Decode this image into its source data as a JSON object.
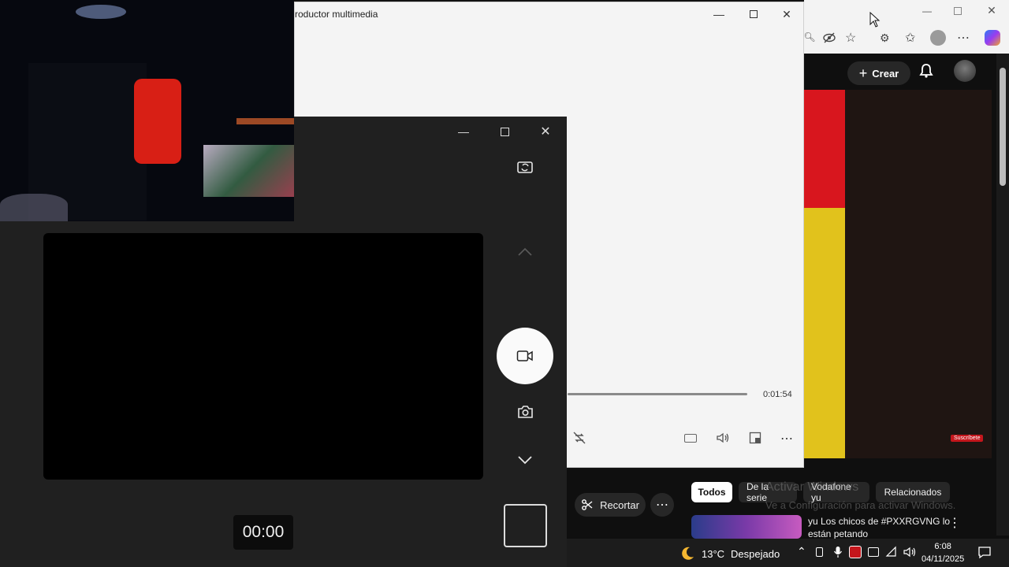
{
  "media_player": {
    "title": "roductor multimedia",
    "time_remaining": "0:01:54"
  },
  "camera": {
    "timer": "00:00"
  },
  "youtube": {
    "create_label": "Crear",
    "subscribe_badge": "Suscríbete",
    "cut_label": "Recortar",
    "more_label": "⋯",
    "chips": [
      "Todos",
      "De la serie",
      "Vodafone yu",
      "Relacionados"
    ],
    "recommended_title": "yu Los chicos de #PXXRGVNG lo están petando",
    "recommended_menu": "⋮"
  },
  "windows_watermark": {
    "title": "Activar Windows",
    "subtitle": "Ve a Configuración para activar Windows."
  },
  "taskbar": {
    "temperature": "13°C",
    "condition": "Despejado",
    "time": "6:08",
    "date": "04/11/2025"
  },
  "colors": {
    "accent_red": "#c4161c",
    "dark_bg": "#202020"
  }
}
